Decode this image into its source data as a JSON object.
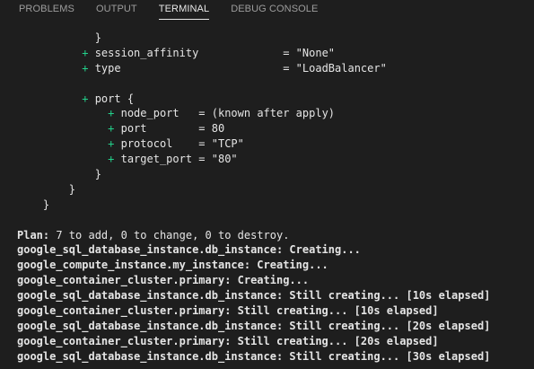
{
  "tabs": [
    {
      "label": "PROBLEMS",
      "active": false
    },
    {
      "label": "OUTPUT",
      "active": false
    },
    {
      "label": "TERMINAL",
      "active": true
    },
    {
      "label": "DEBUG CONSOLE",
      "active": false
    }
  ],
  "terminal": {
    "lines": [
      {
        "kind": "plain",
        "text": "            }"
      },
      {
        "kind": "plus",
        "indent": "          ",
        "text": "session_affinity             = \"None\""
      },
      {
        "kind": "plus",
        "indent": "          ",
        "text": "type                         = \"LoadBalancer\""
      },
      {
        "kind": "blank",
        "text": ""
      },
      {
        "kind": "plus",
        "indent": "          ",
        "text": "port {"
      },
      {
        "kind": "plus",
        "indent": "              ",
        "text": "node_port   = (known after apply)"
      },
      {
        "kind": "plus",
        "indent": "              ",
        "text": "port        = 80"
      },
      {
        "kind": "plus",
        "indent": "              ",
        "text": "protocol    = \"TCP\""
      },
      {
        "kind": "plus",
        "indent": "              ",
        "text": "target_port = \"80\""
      },
      {
        "kind": "plain",
        "text": "            }"
      },
      {
        "kind": "plain",
        "text": "        }"
      },
      {
        "kind": "plain",
        "text": "    }"
      },
      {
        "kind": "blank",
        "text": ""
      },
      {
        "kind": "plan",
        "label": "Plan:",
        "text": " 7 to add, 0 to change, 0 to destroy."
      },
      {
        "kind": "out",
        "text": "google_sql_database_instance.db_instance: Creating..."
      },
      {
        "kind": "out",
        "text": "google_compute_instance.my_instance: Creating..."
      },
      {
        "kind": "out",
        "text": "google_container_cluster.primary: Creating..."
      },
      {
        "kind": "out",
        "text": "google_sql_database_instance.db_instance: Still creating... [10s elapsed]"
      },
      {
        "kind": "out",
        "text": "google_container_cluster.primary: Still creating... [10s elapsed]"
      },
      {
        "kind": "out",
        "text": "google_sql_database_instance.db_instance: Still creating... [20s elapsed]"
      },
      {
        "kind": "out",
        "text": "google_container_cluster.primary: Still creating... [20s elapsed]"
      },
      {
        "kind": "out",
        "text": "google_sql_database_instance.db_instance: Still creating... [30s elapsed]"
      }
    ]
  }
}
